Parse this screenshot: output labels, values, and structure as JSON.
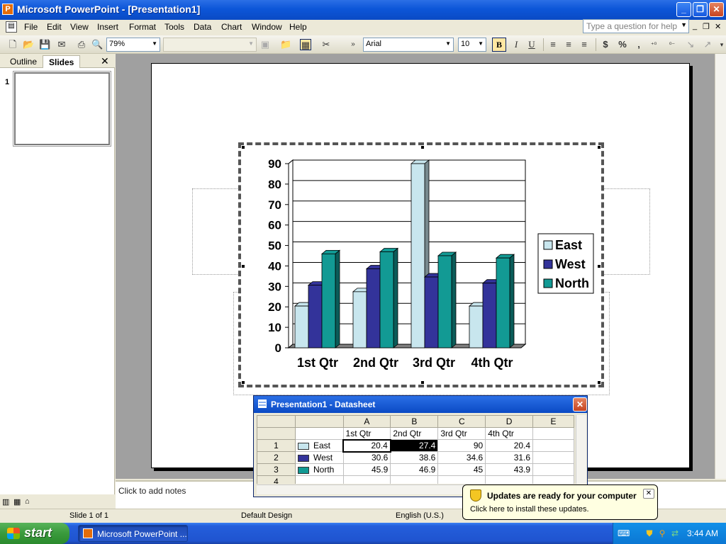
{
  "window": {
    "title": "Microsoft PowerPoint - [Presentation1]"
  },
  "menu": {
    "items": [
      "File",
      "Edit",
      "View",
      "Insert",
      "Format",
      "Tools",
      "Data",
      "Chart",
      "Window",
      "Help"
    ],
    "help_placeholder": "Type a question for help"
  },
  "toolbar": {
    "zoom": "79%",
    "font": "Arial",
    "font_size": "10",
    "bold": "B",
    "italic": "I",
    "underline": "U",
    "currency": "$",
    "percent": "%",
    "comma": ","
  },
  "left_pane": {
    "tabs": [
      "Outline",
      "Slides"
    ],
    "active_tab": "Slides",
    "slide_number": "1"
  },
  "notes": {
    "placeholder": "Click to add notes"
  },
  "status": {
    "slide": "Slide 1 of 1",
    "design": "Default Design",
    "language": "English (U.S.)"
  },
  "datasheet": {
    "title": "Presentation1 - Datasheet",
    "columns": [
      "A",
      "B",
      "C",
      "D",
      "E"
    ],
    "header_row": [
      "1st Qtr",
      "2nd Qtr",
      "3rd Qtr",
      "4th Qtr"
    ],
    "rows": [
      {
        "num": "1",
        "label": "East",
        "values": [
          "20.4",
          "27.4",
          "90",
          "20.4"
        ]
      },
      {
        "num": "2",
        "label": "West",
        "values": [
          "30.6",
          "38.6",
          "34.6",
          "31.6"
        ]
      },
      {
        "num": "3",
        "label": "North",
        "values": [
          "45.9",
          "46.9",
          "45",
          "43.9"
        ]
      }
    ],
    "extra_row_num": "4"
  },
  "balloon": {
    "title": "Updates are ready for your computer",
    "body": "Click here to install these updates."
  },
  "taskbar": {
    "start": "start",
    "item": "Microsoft PowerPoint ...",
    "clock": "3:44 AM"
  },
  "colors": {
    "east": "#c8e6ee",
    "west": "#33339a",
    "north": "#129a94"
  },
  "chart_data": {
    "type": "bar",
    "categories": [
      "1st Qtr",
      "2nd Qtr",
      "3rd Qtr",
      "4th Qtr"
    ],
    "series": [
      {
        "name": "East",
        "values": [
          20.4,
          27.4,
          90,
          20.4
        ]
      },
      {
        "name": "West",
        "values": [
          30.6,
          38.6,
          34.6,
          31.6
        ]
      },
      {
        "name": "North",
        "values": [
          45.9,
          46.9,
          45,
          43.9
        ]
      }
    ],
    "yticks": [
      0,
      10,
      20,
      30,
      40,
      50,
      60,
      70,
      80,
      90
    ],
    "ylim": [
      0,
      90
    ],
    "legend": "right",
    "grid": true
  }
}
